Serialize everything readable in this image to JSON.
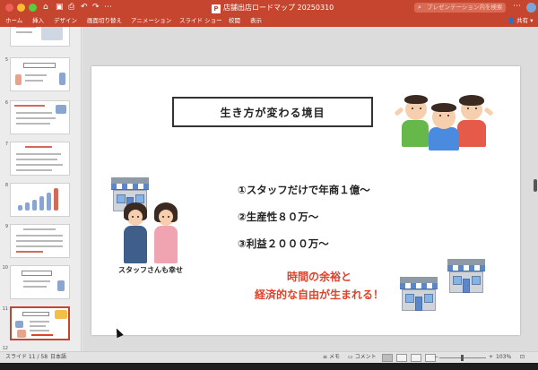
{
  "window": {
    "title": "店舗出店ロードマップ 20250310",
    "search_placeholder": "プレゼンテーション内を検索",
    "quick_icons": [
      "home-icon",
      "save-icon",
      "print-icon",
      "undo-icon",
      "redo-icon",
      "more-icon"
    ]
  },
  "ribbon": {
    "tabs": [
      "ホーム",
      "挿入",
      "デザイン",
      "画面切り替え",
      "アニメーション",
      "スライド ショー",
      "校閲",
      "表示"
    ],
    "share_label": "共有"
  },
  "thumbnails": {
    "numbers": [
      "5",
      "6",
      "7",
      "8",
      "9",
      "10",
      "11"
    ],
    "active": "11",
    "partial_bottom_number": "12"
  },
  "slide": {
    "title": "生き方が変わる境目",
    "points": [
      "①スタッフだけで年商１億～",
      "②生産性８０万～",
      "③利益２０００万～"
    ],
    "message_line1": "時間の余裕と",
    "message_line2": "経済的な自由が生まれる！",
    "couple_caption": "スタッフさんも幸せ",
    "accent_color": "#e2412a"
  },
  "statusbar": {
    "slide_counter": "スライド 11 / 58",
    "language": "日本語",
    "notes_label": "メモ",
    "comments_label": "コメント",
    "zoom": "103%"
  },
  "colors": {
    "ribbon": "#c6452f",
    "active_thumb_border": "#c6452f"
  }
}
